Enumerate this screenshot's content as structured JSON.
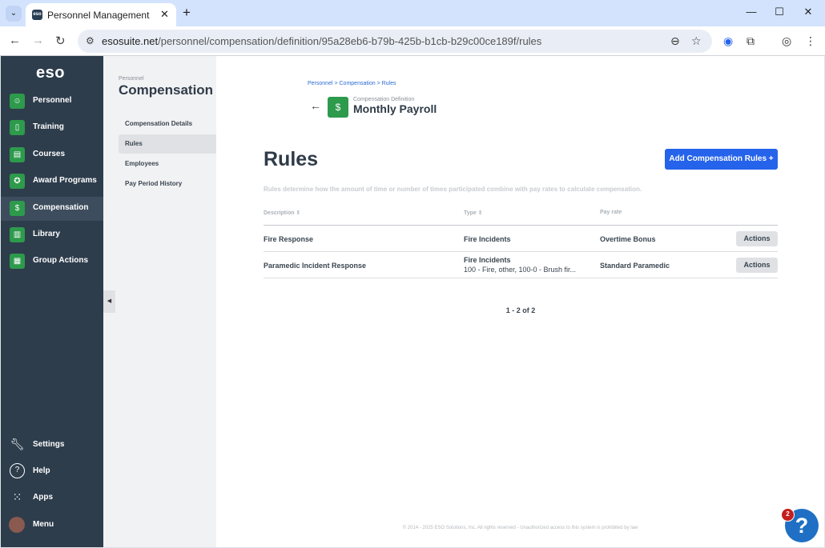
{
  "browser": {
    "tab_title": "Personnel Management",
    "url_host": "esosuite.net",
    "url_path": "/personnel/compensation/definition/95a28eb6-b79b-425b-b1cb-b29c00ce189f/rules"
  },
  "app": {
    "logo": "eso",
    "nav_items": [
      {
        "label": "Personnel",
        "icon": "people-icon"
      },
      {
        "label": "Training",
        "icon": "book-icon"
      },
      {
        "label": "Courses",
        "icon": "certificate-icon"
      },
      {
        "label": "Award Programs",
        "icon": "award-icon"
      },
      {
        "label": "Compensation",
        "icon": "compensation-icon"
      },
      {
        "label": "Library",
        "icon": "library-icon"
      },
      {
        "label": "Group Actions",
        "icon": "group-actions-icon"
      }
    ],
    "bottom_nav": [
      {
        "label": "Settings",
        "icon": "wrench-icon"
      },
      {
        "label": "Help",
        "icon": "help-icon"
      },
      {
        "label": "Apps",
        "icon": "apps-grid-icon"
      },
      {
        "label": "Menu",
        "icon": "avatar"
      }
    ]
  },
  "subnav": {
    "kicker": "Personnel",
    "title": "Compensation",
    "items": [
      {
        "label": "Compensation Details"
      },
      {
        "label": "Rules"
      },
      {
        "label": "Employees"
      },
      {
        "label": "Pay Period History"
      }
    ]
  },
  "header": {
    "breadcrumb": "Personnel > Compensation > Rules",
    "kicker": "Compensation Definition",
    "title": "Monthly Payroll"
  },
  "page": {
    "title": "Rules",
    "add_button": "Add Compensation Rules +",
    "description": "Rules determine how the amount of time or number of times participated combine with pay rates to calculate compensation."
  },
  "table": {
    "columns": [
      "Description ⇕",
      "Type ⇕",
      "Pay rate"
    ],
    "rows": [
      {
        "description": "Fire Response",
        "type_line1": "Fire Incidents",
        "type_line2": "",
        "pay_rate": "Overtime Bonus",
        "action": "Actions"
      },
      {
        "description": "Paramedic Incident Response",
        "type_line1": "Fire Incidents",
        "type_line2": "100 - Fire, other, 100-0 - Brush fir...",
        "pay_rate": "Standard Paramedic",
        "action": "Actions"
      }
    ],
    "pager": "1 - 2 of 2"
  },
  "footer": "© 2014 - 2025 ESO Solutions, Inc. All rights reserved - Unauthorized access to this system is prohibited by law",
  "help": {
    "badge": "2",
    "glyph": "?"
  }
}
